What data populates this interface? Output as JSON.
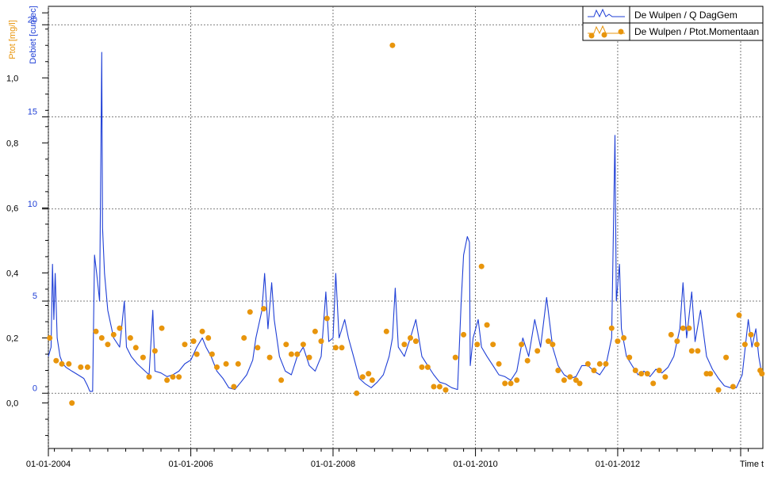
{
  "chart_data": {
    "type": "line",
    "x_axis": {
      "ticks": [
        "01-01-2004",
        "01-01-2006",
        "01-01-2008",
        "01-01-2010",
        "01-01-2012"
      ],
      "end_label": "Time t",
      "range": [
        "2004-01-01",
        "2014-01-15"
      ]
    },
    "left_axis_p": {
      "label": "Ptot [mg/l]",
      "color": "#e8950c",
      "range": [
        -0.14,
        1.22
      ],
      "tick_values": [
        0.0,
        0.2,
        0.4,
        0.6,
        0.8,
        1.0
      ],
      "tick_labels": [
        "0,0",
        "0,2",
        "0,4",
        "0,6",
        "0,8",
        "1,0"
      ]
    },
    "left_axis_q": {
      "label": "Debiet [cumec]",
      "color": "#1f3fd6",
      "range": [
        -3.0,
        21.0
      ],
      "tick_values": [
        0,
        5,
        10,
        15,
        20
      ],
      "tick_labels": [
        "0",
        "5",
        "10",
        "15",
        "20"
      ]
    },
    "grid": true,
    "legend": {
      "placement": "top-right",
      "entries": [
        "De Wulpen / Q DagGem",
        "De Wulpen / Ptot.Momentaan"
      ]
    },
    "series": [
      {
        "name": "De Wulpen / Q DagGem",
        "axis": "q",
        "color": "#1f3fd6",
        "points": [
          [
            "2004-01-01",
            2.0
          ],
          [
            "2004-01-15",
            2.5
          ],
          [
            "2004-01-22",
            7.0
          ],
          [
            "2004-01-29",
            4.0
          ],
          [
            "2004-02-05",
            6.5
          ],
          [
            "2004-02-15",
            3.0
          ],
          [
            "2004-03-01",
            2.0
          ],
          [
            "2004-03-15",
            1.6
          ],
          [
            "2004-04-01",
            1.4
          ],
          [
            "2004-05-01",
            1.2
          ],
          [
            "2004-06-01",
            1.0
          ],
          [
            "2004-07-01",
            0.8
          ],
          [
            "2004-07-20",
            0.4
          ],
          [
            "2004-08-01",
            0.1
          ],
          [
            "2004-08-15",
            0.1
          ],
          [
            "2004-08-25",
            7.5
          ],
          [
            "2004-09-05",
            6.5
          ],
          [
            "2004-09-20",
            5.0
          ],
          [
            "2004-09-28",
            15.0
          ],
          [
            "2004-10-01",
            18.5
          ],
          [
            "2004-10-05",
            9.0
          ],
          [
            "2004-10-15",
            6.5
          ],
          [
            "2004-11-01",
            4.5
          ],
          [
            "2004-12-01",
            3.0
          ],
          [
            "2005-01-01",
            2.5
          ],
          [
            "2005-01-25",
            5.0
          ],
          [
            "2005-02-05",
            2.5
          ],
          [
            "2005-03-01",
            2.0
          ],
          [
            "2005-04-01",
            1.6
          ],
          [
            "2005-05-01",
            1.3
          ],
          [
            "2005-06-01",
            1.0
          ],
          [
            "2005-06-20",
            4.5
          ],
          [
            "2005-07-01",
            1.2
          ],
          [
            "2005-08-01",
            1.1
          ],
          [
            "2005-09-01",
            0.9
          ],
          [
            "2005-10-01",
            1.0
          ],
          [
            "2005-11-01",
            1.2
          ],
          [
            "2005-12-01",
            1.6
          ],
          [
            "2006-01-01",
            1.8
          ],
          [
            "2006-02-01",
            2.5
          ],
          [
            "2006-03-01",
            3.0
          ],
          [
            "2006-03-20",
            2.5
          ],
          [
            "2006-04-15",
            2.0
          ],
          [
            "2006-05-15",
            1.2
          ],
          [
            "2006-06-15",
            0.8
          ],
          [
            "2006-07-15",
            0.3
          ],
          [
            "2006-08-15",
            0.2
          ],
          [
            "2006-09-15",
            0.6
          ],
          [
            "2006-10-15",
            1.0
          ],
          [
            "2006-11-15",
            1.8
          ],
          [
            "2006-12-01",
            3.0
          ],
          [
            "2007-01-01",
            4.5
          ],
          [
            "2007-01-15",
            6.5
          ],
          [
            "2007-02-01",
            3.5
          ],
          [
            "2007-02-20",
            6.0
          ],
          [
            "2007-03-05",
            4.0
          ],
          [
            "2007-04-01",
            2.0
          ],
          [
            "2007-05-01",
            1.2
          ],
          [
            "2007-06-01",
            1.0
          ],
          [
            "2007-07-01",
            2.0
          ],
          [
            "2007-08-01",
            2.5
          ],
          [
            "2007-09-01",
            1.5
          ],
          [
            "2007-10-01",
            1.2
          ],
          [
            "2007-11-01",
            2.0
          ],
          [
            "2007-11-25",
            5.5
          ],
          [
            "2007-12-10",
            2.8
          ],
          [
            "2008-01-01",
            3.0
          ],
          [
            "2008-01-15",
            6.5
          ],
          [
            "2008-02-01",
            3.0
          ],
          [
            "2008-03-01",
            4.0
          ],
          [
            "2008-03-20",
            3.0
          ],
          [
            "2008-04-15",
            2.0
          ],
          [
            "2008-05-15",
            0.8
          ],
          [
            "2008-06-15",
            0.5
          ],
          [
            "2008-07-15",
            0.3
          ],
          [
            "2008-08-15",
            0.6
          ],
          [
            "2008-09-15",
            1.0
          ],
          [
            "2008-10-15",
            2.0
          ],
          [
            "2008-11-01",
            3.0
          ],
          [
            "2008-11-15",
            5.7
          ],
          [
            "2008-12-01",
            2.5
          ],
          [
            "2009-01-01",
            2.0
          ],
          [
            "2009-02-01",
            3.0
          ],
          [
            "2009-03-01",
            4.0
          ],
          [
            "2009-04-01",
            2.0
          ],
          [
            "2009-05-01",
            1.5
          ],
          [
            "2009-06-01",
            1.0
          ],
          [
            "2009-07-01",
            0.6
          ],
          [
            "2009-08-01",
            0.5
          ],
          [
            "2009-09-01",
            0.3
          ],
          [
            "2009-10-01",
            0.2
          ],
          [
            "2009-10-20",
            5.0
          ],
          [
            "2009-11-01",
            7.5
          ],
          [
            "2009-11-20",
            8.5
          ],
          [
            "2009-12-01",
            8.2
          ],
          [
            "2009-12-05",
            1.5
          ],
          [
            "2009-12-20",
            3.0
          ],
          [
            "2010-01-15",
            4.0
          ],
          [
            "2010-02-01",
            2.5
          ],
          [
            "2010-03-01",
            2.0
          ],
          [
            "2010-04-01",
            1.5
          ],
          [
            "2010-05-01",
            1.0
          ],
          [
            "2010-06-01",
            0.9
          ],
          [
            "2010-07-01",
            0.7
          ],
          [
            "2010-08-01",
            1.2
          ],
          [
            "2010-09-01",
            3.0
          ],
          [
            "2010-10-01",
            2.0
          ],
          [
            "2010-11-01",
            4.0
          ],
          [
            "2010-12-01",
            2.5
          ],
          [
            "2011-01-01",
            5.2
          ],
          [
            "2011-02-01",
            2.5
          ],
          [
            "2011-03-01",
            1.5
          ],
          [
            "2011-04-01",
            1.0
          ],
          [
            "2011-05-01",
            0.8
          ],
          [
            "2011-06-01",
            0.9
          ],
          [
            "2011-07-01",
            1.5
          ],
          [
            "2011-08-01",
            1.5
          ],
          [
            "2011-09-01",
            1.2
          ],
          [
            "2011-10-01",
            1.0
          ],
          [
            "2011-11-01",
            1.5
          ],
          [
            "2011-12-01",
            3.0
          ],
          [
            "2011-12-18",
            14.0
          ],
          [
            "2011-12-25",
            5.0
          ],
          [
            "2012-01-10",
            7.0
          ],
          [
            "2012-01-20",
            3.5
          ],
          [
            "2012-02-15",
            2.0
          ],
          [
            "2012-03-15",
            1.5
          ],
          [
            "2012-04-15",
            1.0
          ],
          [
            "2012-05-15",
            1.2
          ],
          [
            "2012-06-15",
            0.9
          ],
          [
            "2012-07-15",
            1.3
          ],
          [
            "2012-08-15",
            1.1
          ],
          [
            "2012-09-15",
            1.4
          ],
          [
            "2012-10-15",
            2.0
          ],
          [
            "2012-11-15",
            3.5
          ],
          [
            "2012-12-01",
            6.0
          ],
          [
            "2012-12-20",
            3.0
          ],
          [
            "2013-01-15",
            5.5
          ],
          [
            "2013-02-01",
            2.8
          ],
          [
            "2013-03-01",
            4.5
          ],
          [
            "2013-04-01",
            2.0
          ],
          [
            "2013-05-01",
            1.3
          ],
          [
            "2013-06-01",
            0.8
          ],
          [
            "2013-07-01",
            0.4
          ],
          [
            "2013-08-01",
            0.3
          ],
          [
            "2013-09-01",
            0.3
          ],
          [
            "2013-10-01",
            1.0
          ],
          [
            "2013-11-01",
            4.0
          ],
          [
            "2013-11-20",
            2.5
          ],
          [
            "2013-12-10",
            3.5
          ],
          [
            "2013-12-25",
            2.0
          ],
          [
            "2014-01-10",
            1.0
          ]
        ]
      },
      {
        "name": "De Wulpen / Ptot.Momentaan",
        "axis": "p",
        "color": "#e8950c",
        "points": [
          [
            "2004-01-08",
            0.2
          ],
          [
            "2004-02-10",
            0.13
          ],
          [
            "2004-03-10",
            0.12
          ],
          [
            "2004-04-15",
            0.12
          ],
          [
            "2004-05-01",
            0.0
          ],
          [
            "2004-06-15",
            0.11
          ],
          [
            "2004-07-20",
            0.11
          ],
          [
            "2004-09-01",
            0.22
          ],
          [
            "2004-10-01",
            0.2
          ],
          [
            "2004-11-01",
            0.18
          ],
          [
            "2004-12-01",
            0.21
          ],
          [
            "2005-01-01",
            0.23
          ],
          [
            "2005-02-25",
            0.2
          ],
          [
            "2005-03-25",
            0.17
          ],
          [
            "2005-05-01",
            0.14
          ],
          [
            "2005-06-01",
            0.08
          ],
          [
            "2005-07-01",
            0.16
          ],
          [
            "2005-08-05",
            0.23
          ],
          [
            "2005-09-01",
            0.07
          ],
          [
            "2005-10-01",
            0.08
          ],
          [
            "2005-11-01",
            0.08
          ],
          [
            "2005-12-01",
            0.18
          ],
          [
            "2006-01-15",
            0.19
          ],
          [
            "2006-02-01",
            0.15
          ],
          [
            "2006-03-01",
            0.22
          ],
          [
            "2006-04-01",
            0.2
          ],
          [
            "2006-04-20",
            0.15
          ],
          [
            "2006-05-15",
            0.11
          ],
          [
            "2006-07-01",
            0.12
          ],
          [
            "2006-08-10",
            0.05
          ],
          [
            "2006-09-01",
            0.12
          ],
          [
            "2006-10-01",
            0.2
          ],
          [
            "2006-11-01",
            0.28
          ],
          [
            "2006-12-10",
            0.17
          ],
          [
            "2007-01-10",
            0.29
          ],
          [
            "2007-02-10",
            0.14
          ],
          [
            "2007-04-10",
            0.07
          ],
          [
            "2007-05-05",
            0.18
          ],
          [
            "2007-06-01",
            0.15
          ],
          [
            "2007-07-01",
            0.15
          ],
          [
            "2007-08-01",
            0.18
          ],
          [
            "2007-09-01",
            0.14
          ],
          [
            "2007-10-01",
            0.22
          ],
          [
            "2007-11-01",
            0.19
          ],
          [
            "2007-12-01",
            0.26
          ],
          [
            "2008-01-15",
            0.17
          ],
          [
            "2008-02-15",
            0.17
          ],
          [
            "2008-05-01",
            0.03
          ],
          [
            "2008-06-01",
            0.08
          ],
          [
            "2008-07-01",
            0.09
          ],
          [
            "2008-07-20",
            0.07
          ],
          [
            "2008-10-01",
            0.22
          ],
          [
            "2008-11-01",
            1.1
          ],
          [
            "2009-01-01",
            0.18
          ],
          [
            "2009-02-01",
            0.2
          ],
          [
            "2009-03-01",
            0.19
          ],
          [
            "2009-04-01",
            0.11
          ],
          [
            "2009-05-01",
            0.11
          ],
          [
            "2009-06-01",
            0.05
          ],
          [
            "2009-07-01",
            0.05
          ],
          [
            "2009-08-01",
            0.04
          ],
          [
            "2009-09-20",
            0.14
          ],
          [
            "2009-11-01",
            0.21
          ],
          [
            "2010-01-10",
            0.18
          ],
          [
            "2010-02-01",
            0.42
          ],
          [
            "2010-03-01",
            0.24
          ],
          [
            "2010-04-01",
            0.18
          ],
          [
            "2010-05-01",
            0.12
          ],
          [
            "2010-06-01",
            0.06
          ],
          [
            "2010-07-01",
            0.06
          ],
          [
            "2010-08-01",
            0.07
          ],
          [
            "2010-08-25",
            0.18
          ],
          [
            "2010-09-25",
            0.13
          ],
          [
            "2010-11-15",
            0.16
          ],
          [
            "2011-01-10",
            0.19
          ],
          [
            "2011-02-01",
            0.18
          ],
          [
            "2011-03-01",
            0.1
          ],
          [
            "2011-04-01",
            0.07
          ],
          [
            "2011-05-01",
            0.08
          ],
          [
            "2011-06-01",
            0.07
          ],
          [
            "2011-06-20",
            0.06
          ],
          [
            "2011-08-01",
            0.12
          ],
          [
            "2011-09-01",
            0.1
          ],
          [
            "2011-10-01",
            0.12
          ],
          [
            "2011-11-01",
            0.12
          ],
          [
            "2011-12-01",
            0.23
          ],
          [
            "2012-01-01",
            0.19
          ],
          [
            "2012-02-01",
            0.2
          ],
          [
            "2012-03-01",
            0.14
          ],
          [
            "2012-04-01",
            0.1
          ],
          [
            "2012-05-01",
            0.09
          ],
          [
            "2012-06-01",
            0.09
          ],
          [
            "2012-07-01",
            0.06
          ],
          [
            "2012-08-01",
            0.1
          ],
          [
            "2012-09-01",
            0.08
          ],
          [
            "2012-10-01",
            0.21
          ],
          [
            "2012-11-01",
            0.19
          ],
          [
            "2012-12-01",
            0.23
          ],
          [
            "2013-01-01",
            0.23
          ],
          [
            "2013-01-15",
            0.16
          ],
          [
            "2013-02-15",
            0.16
          ],
          [
            "2013-04-01",
            0.09
          ],
          [
            "2013-04-20",
            0.09
          ],
          [
            "2013-06-01",
            0.04
          ],
          [
            "2013-07-10",
            0.14
          ],
          [
            "2013-08-15",
            0.05
          ],
          [
            "2013-09-15",
            0.27
          ],
          [
            "2013-10-15",
            0.18
          ],
          [
            "2013-11-15",
            0.21
          ],
          [
            "2013-12-15",
            0.18
          ],
          [
            "2014-01-01",
            0.1
          ],
          [
            "2014-01-10",
            0.09
          ]
        ]
      }
    ]
  }
}
